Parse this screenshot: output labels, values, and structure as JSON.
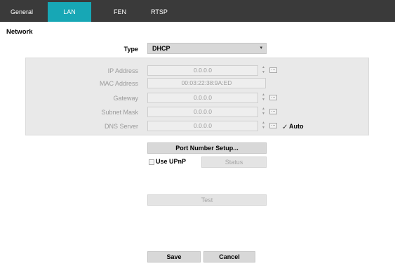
{
  "tabs": [
    {
      "label": "General",
      "active": false
    },
    {
      "label": "LAN",
      "active": true
    },
    {
      "label": "FEN",
      "active": false
    },
    {
      "label": "RTSP",
      "active": false
    }
  ],
  "section_title": "Network",
  "type": {
    "label": "Type",
    "value": "DHCP"
  },
  "fields": {
    "ip_address": {
      "label": "IP Address",
      "value": "0.0.0.0"
    },
    "mac_address": {
      "label": "MAC Address",
      "value": "00:03:22:38:9A:ED"
    },
    "gateway": {
      "label": "Gateway",
      "value": "0.0.0.0"
    },
    "subnet_mask": {
      "label": "Subnet Mask",
      "value": "0.0.0.0"
    },
    "dns_server": {
      "label": "DNS Server",
      "value": "0.0.0.0"
    }
  },
  "auto": {
    "label": "Auto",
    "checked": true
  },
  "buttons": {
    "port_setup": "Port Number Setup...",
    "status": "Status",
    "test": "Test",
    "save": "Save",
    "cancel": "Cancel"
  },
  "use_upnp": {
    "label": "Use UPnP",
    "checked": false
  },
  "colors": {
    "tab_active": "#17a7b5",
    "tabbar": "#3a3a3a"
  }
}
